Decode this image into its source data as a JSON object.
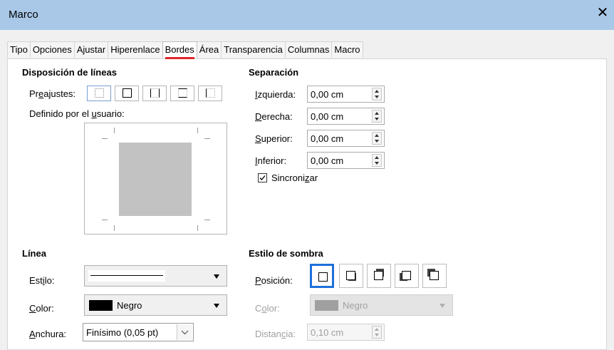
{
  "window": {
    "title": "Marco",
    "close_icon": "close-icon"
  },
  "tabs": [
    {
      "label": "Tipo"
    },
    {
      "label": "Opciones"
    },
    {
      "label": "Ajustar"
    },
    {
      "label": "Hiperenlace"
    },
    {
      "label": "Bordes",
      "active": true
    },
    {
      "label": "Área"
    },
    {
      "label": "Transparencia"
    },
    {
      "label": "Columnas"
    },
    {
      "label": "Macro"
    }
  ],
  "line_arrangement": {
    "heading": "Disposición de líneas",
    "presets_label_a": "Pr",
    "presets_label_u": "e",
    "presets_label_b": "ajustes:",
    "presets": [
      "preset-none-icon",
      "preset-all-borders-icon",
      "preset-left-right-icon",
      "preset-top-bottom-icon",
      "preset-left-only-icon"
    ],
    "user_defined_a": "Definido por el ",
    "user_defined_u": "u",
    "user_defined_b": "suario:"
  },
  "spacing": {
    "heading": "Separación",
    "fields": [
      {
        "label_u": "I",
        "label_rest": "zquierda:",
        "value": "0,00 cm"
      },
      {
        "label_u": "D",
        "label_rest": "erecha:",
        "value": "0,00 cm"
      },
      {
        "label_u": "S",
        "label_rest": "uperior:",
        "value": "0,00 cm"
      },
      {
        "label_u": "I",
        "label_rest": "nferior:",
        "value": "0,00 cm"
      }
    ],
    "sync_label_a": "Sincroni",
    "sync_label_u": "z",
    "sync_label_b": "ar",
    "sync_checked": true
  },
  "line": {
    "heading": "Línea",
    "style_label_a": "Est",
    "style_label_u": "i",
    "style_label_b": "lo:",
    "color_label_u": "C",
    "color_label_rest": "olor:",
    "color_value": "Negro",
    "color_swatch": "#000000",
    "width_label_u": "A",
    "width_label_rest": "nchura:",
    "width_value": "Finísimo (0,05 pt)"
  },
  "shadow": {
    "heading": "Estilo de sombra",
    "position_label_u": "P",
    "position_label_rest": "osición:",
    "positions": [
      "no-shadow-icon",
      "shadow-bottom-right-icon",
      "shadow-top-right-icon",
      "shadow-bottom-left-icon",
      "shadow-top-left-icon"
    ],
    "color_label_a": "C",
    "color_label_u": "o",
    "color_label_b": "lor:",
    "color_value": "Negro",
    "color_swatch": "#a0a0a0",
    "distance_label_a": "Distan",
    "distance_label_u": "c",
    "distance_label_b": "ia:",
    "distance_value": "0,10 cm"
  },
  "colors": {
    "accent": "#1e6fd9",
    "tab_indicator": "#e0262b",
    "titlebar": "#a9c8e8"
  }
}
